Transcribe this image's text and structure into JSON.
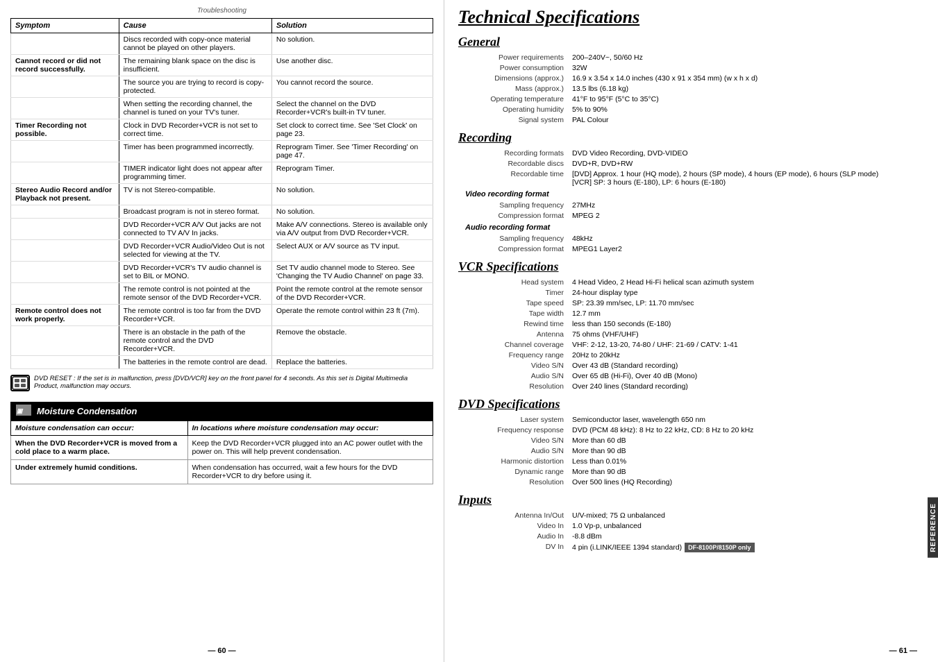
{
  "left": {
    "header": "Troubleshooting",
    "page_number": "— 60 —",
    "trouble_table": {
      "headers": [
        "Symptom",
        "Cause",
        "Solution"
      ],
      "rows": [
        {
          "symptom": "",
          "cause": "Discs recorded with copy-once material cannot be played on other players.",
          "solution": "No solution."
        },
        {
          "symptom": "Cannot record or did not record successfully.",
          "cause": "The remaining blank space on the disc is insufficient.",
          "solution": "Use another disc."
        },
        {
          "symptom": "",
          "cause": "The source you are trying to record is copy-protected.",
          "solution": "You cannot record the source."
        },
        {
          "symptom": "",
          "cause": "When setting the recording channel, the channel is tuned on your TV's tuner.",
          "solution": "Select the channel on the DVD Recorder+VCR's built-in TV tuner."
        },
        {
          "symptom": "Timer Recording not possible.",
          "cause": "Clock in DVD Recorder+VCR is not set to correct time.",
          "solution": "Set clock to correct time. See 'Set Clock' on page 23."
        },
        {
          "symptom": "",
          "cause": "Timer has been programmed incorrectly.",
          "solution": "Reprogram Timer. See 'Timer Recording' on page 47."
        },
        {
          "symptom": "",
          "cause": "TIMER indicator light does not appear after programming timer.",
          "solution": "Reprogram Timer."
        },
        {
          "symptom": "Stereo Audio Record and/or Playback not present.",
          "cause": "TV is not Stereo-compatible.",
          "solution": "No solution."
        },
        {
          "symptom": "",
          "cause": "Broadcast program is not in stereo format.",
          "solution": "No solution."
        },
        {
          "symptom": "",
          "cause": "DVD Recorder+VCR A/V Out jacks are not connected to TV A/V In jacks.",
          "solution": "Make A/V connections. Stereo is available only via A/V output from DVD Recorder+VCR."
        },
        {
          "symptom": "",
          "cause": "DVD Recorder+VCR Audio/Video Out is not selected for viewing at the TV.",
          "solution": "Select AUX or A/V source as TV input."
        },
        {
          "symptom": "",
          "cause": "DVD Recorder+VCR's TV audio channel is set to BIL or MONO.",
          "solution": "Set TV audio channel mode to Stereo. See 'Changing the TV Audio Channel' on page 33."
        },
        {
          "symptom": "",
          "cause": "The remote control is not pointed at the remote sensor of the DVD Recorder+VCR.",
          "solution": "Point the remote control at the remote sensor of the DVD Recorder+VCR."
        },
        {
          "symptom": "Remote control does not work properly.",
          "cause": "The remote control is too far from the DVD Recorder+VCR.",
          "solution": "Operate the remote control within 23 ft (7m)."
        },
        {
          "symptom": "",
          "cause": "There is an obstacle in the path of the remote control and the DVD Recorder+VCR.",
          "solution": "Remove the obstacle."
        },
        {
          "symptom": "",
          "cause": "The batteries in the remote control are dead.",
          "solution": "Replace the batteries."
        }
      ]
    },
    "dvd_reset_note": "DVD RESET : If the set is in malfunction, press [DVD/VCR] key on the front panel for 4 seconds. As this set is Digital Multimedia Product, malfunction may occurs.",
    "moisture_section": {
      "title": "Moisture Condensation",
      "table": {
        "headers": [
          "Moisture condensation can occur:",
          "In locations where moisture condensation may occur:"
        ],
        "rows": [
          {
            "condition": "When the DVD Recorder+VCR is moved from a cold place to a warm place.",
            "location": "Keep the DVD Recorder+VCR plugged into an AC power outlet with the power on. This will help prevent condensation."
          },
          {
            "condition": "Under extremely humid conditions.",
            "location": "When condensation has occurred, wait a few hours for the DVD Recorder+VCR to dry before using it."
          }
        ]
      }
    }
  },
  "right": {
    "page_title": "Technical Specifications",
    "page_number": "— 61 —",
    "reference_tab": "REFERENCE",
    "sections": {
      "general": {
        "title": "General",
        "specs": [
          {
            "label": "Power requirements",
            "value": "200–240V~, 50/60 Hz"
          },
          {
            "label": "Power consumption",
            "value": "32W"
          },
          {
            "label": "Dimensions (approx.)",
            "value": "16.9 x 3.54 x 14.0 inches (430 x 91 x 354 mm) (w x h x d)"
          },
          {
            "label": "Mass (approx.)",
            "value": "13.5 lbs (6.18 kg)"
          },
          {
            "label": "Operating temperature",
            "value": "41°F to 95°F (5°C to 35°C)"
          },
          {
            "label": "Operating humidity",
            "value": "5% to 90%"
          },
          {
            "label": "Signal system",
            "value": "PAL Colour"
          }
        ]
      },
      "recording": {
        "title": "Recording",
        "specs": [
          {
            "label": "Recording formats",
            "value": "DVD Video Recording, DVD-VIDEO"
          },
          {
            "label": "Recordable discs",
            "value": "DVD+R, DVD+RW"
          },
          {
            "label": "Recordable time",
            "value": "[DVD] Approx. 1 hour (HQ mode), 2 hours (SP mode), 4 hours (EP mode), 6 hours (SLP mode)\n[VCR] SP: 3 hours (E-180), LP: 6 hours (E-180)"
          }
        ],
        "video_recording_format": {
          "subtitle": "Video recording format",
          "specs": [
            {
              "label": "Sampling frequency",
              "value": "27MHz"
            },
            {
              "label": "Compression format",
              "value": "MPEG 2"
            }
          ]
        },
        "audio_recording_format": {
          "subtitle": "Audio recording format",
          "specs": [
            {
              "label": "Sampling frequency",
              "value": "48kHz"
            },
            {
              "label": "Compression format",
              "value": "MPEG1 Layer2"
            }
          ]
        }
      },
      "vcr_specs": {
        "title": "VCR Specifications",
        "specs": [
          {
            "label": "Head system",
            "value": "4 Head Video, 2 Head Hi-Fi helical scan azimuth system"
          },
          {
            "label": "Timer",
            "value": "24-hour display type"
          },
          {
            "label": "Tape speed",
            "value": "SP: 23.39 mm/sec, LP: 11.70 mm/sec"
          },
          {
            "label": "Tape width",
            "value": "12.7 mm"
          },
          {
            "label": "Rewind time",
            "value": "less than 150 seconds (E-180)"
          },
          {
            "label": "Antenna",
            "value": "75 ohms (VHF/UHF)"
          },
          {
            "label": "Channel coverage",
            "value": "VHF: 2-12, 13-20, 74-80 / UHF: 21-69 / CATV: 1-41"
          },
          {
            "label": "Frequency range",
            "value": "20Hz to 20kHz"
          },
          {
            "label": "Video S/N",
            "value": "Over 43 dB (Standard recording)"
          },
          {
            "label": "Audio S/N",
            "value": "Over 65 dB (Hi-Fi), Over 40 dB (Mono)"
          },
          {
            "label": "Resolution",
            "value": "Over 240 lines (Standard recording)"
          }
        ]
      },
      "dvd_specs": {
        "title": "DVD Specifications",
        "specs": [
          {
            "label": "Laser system",
            "value": "Semiconductor laser, wavelength 650 nm"
          },
          {
            "label": "Frequency response",
            "value": "DVD (PCM 48 kHz): 8 Hz to 22 kHz, CD: 8 Hz to 20 kHz"
          },
          {
            "label": "Video S/N",
            "value": "More than 60 dB"
          },
          {
            "label": "Audio S/N",
            "value": "More than 90 dB"
          },
          {
            "label": "Harmonic distortion",
            "value": "Less than 0.01%"
          },
          {
            "label": "Dynamic range",
            "value": "More than 90 dB"
          },
          {
            "label": "Resolution",
            "value": "Over 500 lines (HQ Recording)"
          }
        ]
      },
      "inputs": {
        "title": "Inputs",
        "specs": [
          {
            "label": "Antenna In/Out",
            "value": "U/V-mixed; 75 Ω unbalanced"
          },
          {
            "label": "Video In",
            "value": "1.0 Vp-p, unbalanced"
          },
          {
            "label": "Audio In",
            "value": "-8.8 dBm"
          },
          {
            "label": "DV In",
            "value": "4 pin (i.LINK/IEEE 1394 standard)"
          }
        ],
        "df_badge": "DF-8100P/8150P only"
      }
    }
  }
}
